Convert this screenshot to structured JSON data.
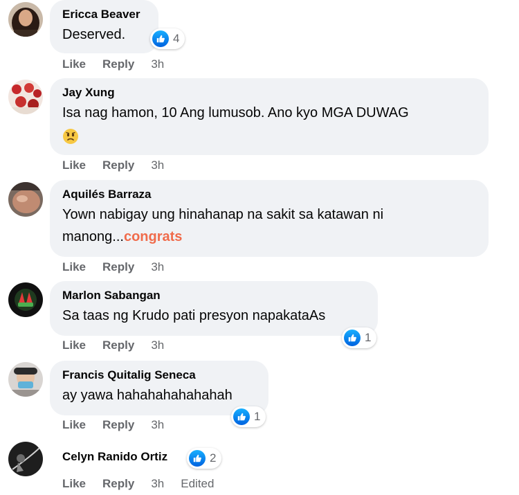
{
  "actions": {
    "like_label": "Like",
    "reply_label": "Reply"
  },
  "comments": [
    {
      "author": "Ericca Beaver",
      "text": "Deserved.",
      "time": "3h",
      "reactions": {
        "type": "like",
        "count": "4"
      }
    },
    {
      "author": "Jay Xung",
      "text": "Isa nag hamon, 10 Ang lumusob. Ano kyo MGA DUWAG",
      "emoji": "worried-face-icon",
      "time": "3h"
    },
    {
      "author": "Aquilés Barraza",
      "text": "Yown nabigay ung hinahanap na sakit sa katawan ni manong...",
      "mention": "congrats",
      "time": "3h"
    },
    {
      "author": "Marlon Sabangan",
      "text": "Sa taas ng Krudo pati presyon napakataAs",
      "time": "3h",
      "reactions": {
        "type": "like",
        "count": "1"
      }
    },
    {
      "author": "Francis Quitalig Seneca",
      "text": "ay yawa hahahahahahahah",
      "time": "3h",
      "reactions": {
        "type": "like",
        "count": "1"
      }
    },
    {
      "author": "Celyn Ranido Ortiz",
      "time": "3h",
      "edited": "Edited",
      "reactions": {
        "type": "like",
        "count": "2"
      }
    }
  ],
  "colors": {
    "bubble_bg": "#f0f2f5",
    "meta_text": "#65676b",
    "mention": "#f06b4b",
    "like_blue": "#1877f2"
  }
}
